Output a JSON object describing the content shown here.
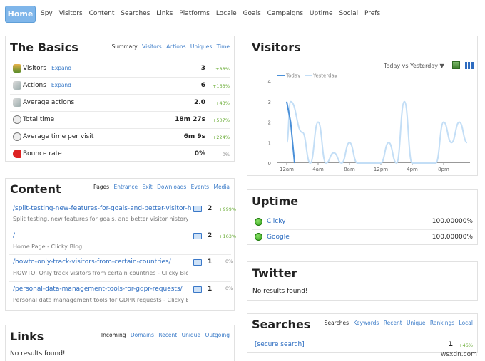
{
  "nav": {
    "home": "Home",
    "items": [
      "Spy",
      "Visitors",
      "Content",
      "Searches",
      "Links",
      "Platforms",
      "Locale",
      "Goals",
      "Campaigns",
      "Uptime",
      "Social",
      "Prefs"
    ]
  },
  "basics": {
    "title": "The Basics",
    "tabs": [
      "Summary",
      "Visitors",
      "Actions",
      "Uniques",
      "Time"
    ],
    "rows": [
      {
        "label": "Visitors",
        "expand": "Expand",
        "value": "3",
        "pct": "+88%"
      },
      {
        "label": "Actions",
        "expand": "Expand",
        "value": "6",
        "pct": "+163%"
      },
      {
        "label": "Average actions",
        "expand": "",
        "value": "2.0",
        "pct": "+43%"
      },
      {
        "label": "Total time",
        "expand": "",
        "value": "18m 27s",
        "pct": "+507%"
      },
      {
        "label": "Average time per visit",
        "expand": "",
        "value": "6m 9s",
        "pct": "+224%"
      },
      {
        "label": "Bounce rate",
        "expand": "",
        "value": "0%",
        "pct": "0%"
      }
    ]
  },
  "content": {
    "title": "Content",
    "tabs": [
      "Pages",
      "Entrance",
      "Exit",
      "Downloads",
      "Events",
      "Media"
    ],
    "rows": [
      {
        "link": "/split-testing-new-features-for-goals-and-better-visitor-h...",
        "sub": "Split testing, new features for goals, and better visitor history...",
        "value": "2",
        "pct": "+999%"
      },
      {
        "link": "/",
        "sub": "Home Page - Clicky Blog",
        "value": "2",
        "pct": "+163%"
      },
      {
        "link": "/howto-only-track-visitors-from-certain-countries/",
        "sub": "HOWTO: Only track visitors from certain countries - Clicky Blog",
        "value": "1",
        "pct": "0%"
      },
      {
        "link": "/personal-data-management-tools-for-gdpr-requests/",
        "sub": "Personal data management tools for GDPR requests - Clicky Bl...",
        "value": "1",
        "pct": "0%"
      }
    ]
  },
  "links": {
    "title": "Links",
    "tabs": [
      "Incoming",
      "Domains",
      "Recent",
      "Unique",
      "Outgoing"
    ],
    "empty": "No results found!"
  },
  "visitors": {
    "title": "Visitors",
    "compare": "Today vs Yesterday ▼",
    "legend_today": "Today",
    "legend_yesterday": "Yesterday"
  },
  "chart_data": {
    "type": "line",
    "x_labels": [
      "12am",
      "4am",
      "8am",
      "12pm",
      "4pm",
      "8pm"
    ],
    "y_ticks": [
      "4",
      "3",
      "2",
      "1",
      "0"
    ],
    "ylim": [
      0,
      4
    ],
    "series": [
      {
        "name": "Today",
        "color": "#4a90d9",
        "values": [
          [
            0,
            3
          ],
          [
            0.5,
            2
          ],
          [
            1,
            0
          ]
        ]
      },
      {
        "name": "Yesterday",
        "color": "#b9daf5",
        "values": [
          [
            0,
            1
          ],
          [
            0.5,
            3
          ],
          [
            2,
            1.5
          ],
          [
            3,
            0
          ],
          [
            4,
            2
          ],
          [
            5,
            0
          ],
          [
            6,
            0.5
          ],
          [
            7,
            0
          ],
          [
            8,
            1
          ],
          [
            9,
            0
          ],
          [
            10,
            0
          ],
          [
            11,
            0
          ],
          [
            12,
            0
          ],
          [
            13,
            1
          ],
          [
            14,
            0
          ],
          [
            15,
            3
          ],
          [
            16,
            0
          ],
          [
            17,
            0
          ],
          [
            18,
            0
          ],
          [
            19,
            0
          ],
          [
            20,
            2
          ],
          [
            21,
            1
          ],
          [
            22,
            2
          ],
          [
            23,
            1
          ]
        ]
      }
    ]
  },
  "uptime": {
    "title": "Uptime",
    "rows": [
      {
        "name": "Clicky",
        "value": "100.00000%"
      },
      {
        "name": "Google",
        "value": "100.00000%"
      }
    ]
  },
  "twitter": {
    "title": "Twitter",
    "empty": "No results found!"
  },
  "searches": {
    "title": "Searches",
    "tabs": [
      "Searches",
      "Keywords",
      "Recent",
      "Unique",
      "Rankings",
      "Local"
    ],
    "rows": [
      {
        "term": "[secure search]",
        "value": "1",
        "pct": "+46%"
      }
    ]
  },
  "watermark": "wsxdn.com"
}
